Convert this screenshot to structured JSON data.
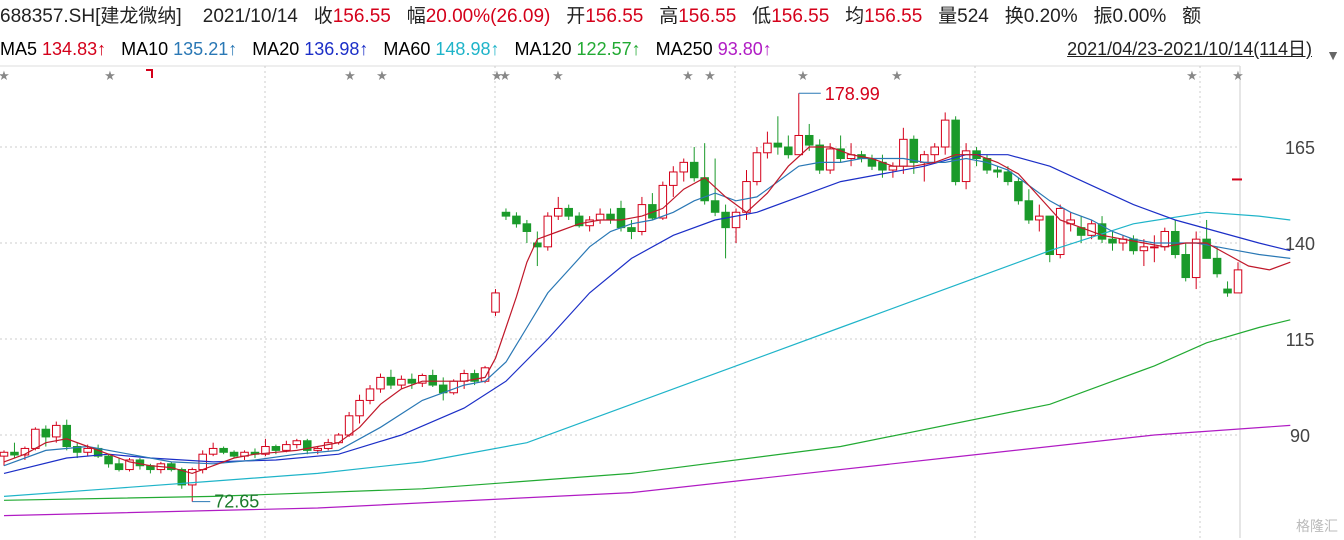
{
  "header": {
    "code": "688357.SH[建龙微纳]",
    "date": "2021/10/14",
    "close_label": "收",
    "close": "156.55",
    "change_label": "幅",
    "change": "20.00%(26.09)",
    "open_label": "开",
    "open": "156.55",
    "high_label": "高",
    "high": "156.55",
    "low_label": "低",
    "low": "156.55",
    "avg_label": "均",
    "avg": "156.55",
    "vol_label": "量",
    "vol": "524",
    "turnover_label": "换",
    "turnover": "0.20%",
    "amp_label": "振",
    "amp": "0.00%",
    "amount_label": "额"
  },
  "ma_bar": {
    "items": [
      {
        "label": "MA5",
        "value": "134.83↑",
        "color": "#c0182a"
      },
      {
        "label": "MA10",
        "value": "135.21↑",
        "color": "#2a78b5"
      },
      {
        "label": "MA20",
        "value": "136.98↑",
        "color": "#1c2fc7"
      },
      {
        "label": "MA60",
        "value": "148.98↑",
        "color": "#1fb4c9"
      },
      {
        "label": "MA120",
        "value": "122.57↑",
        "color": "#22aa33"
      },
      {
        "label": "MA250",
        "value": "93.80↑",
        "color": "#b01bc4"
      }
    ],
    "date_range": "2021/04/23-2021/10/14(114日)",
    "dropdown_icon": "chevron-down-icon"
  },
  "chart_data": {
    "type": "candlestick",
    "y_ticks": [
      165,
      140,
      115,
      90
    ],
    "ylim": [
      70,
      185
    ],
    "annotations": {
      "high": "178.99",
      "low": "72.65"
    },
    "colors": {
      "up": "#d4001a",
      "down": "#1a9a2a",
      "grid": "#cccccc"
    },
    "candles": [
      [
        84.5,
        86,
        82,
        85.5
      ],
      [
        85.5,
        88,
        84,
        84.8
      ],
      [
        84.8,
        87,
        83.5,
        86.5
      ],
      [
        86.5,
        92,
        86,
        91.5
      ],
      [
        91.5,
        92.5,
        87,
        89.5
      ],
      [
        89.5,
        93.5,
        88,
        92.5
      ],
      [
        92.5,
        94,
        86,
        87
      ],
      [
        87,
        88,
        84,
        85.5
      ],
      [
        85.5,
        87.5,
        84.5,
        86.5
      ],
      [
        86.5,
        87.5,
        84,
        84.5
      ],
      [
        84.5,
        85,
        81.5,
        82.5
      ],
      [
        82.5,
        84,
        80.5,
        81
      ],
      [
        81,
        84,
        80.5,
        83.5
      ],
      [
        83.5,
        84,
        81,
        82
      ],
      [
        82,
        82.5,
        80,
        81
      ],
      [
        81,
        83,
        80,
        82.5
      ],
      [
        82.5,
        83,
        80.5,
        81
      ],
      [
        81,
        81.5,
        76,
        77
      ],
      [
        77,
        81.5,
        72.65,
        81
      ],
      [
        81,
        86,
        80,
        85
      ],
      [
        85,
        88,
        84.5,
        86.5
      ],
      [
        86.5,
        87,
        85,
        85.5
      ],
      [
        85.5,
        86,
        84,
        84.5
      ],
      [
        84.5,
        86,
        83.5,
        85.5
      ],
      [
        85.5,
        86.5,
        84,
        85
      ],
      [
        85,
        89,
        84.5,
        87
      ],
      [
        87,
        87.5,
        85,
        86
      ],
      [
        86,
        88.5,
        85.5,
        87.5
      ],
      [
        87.5,
        89,
        86.5,
        88.5
      ],
      [
        88.5,
        89,
        85,
        86
      ],
      [
        86,
        87,
        85,
        86.5
      ],
      [
        86.5,
        89,
        86,
        88
      ],
      [
        88,
        90.5,
        87.5,
        90
      ],
      [
        90,
        96,
        89.5,
        95
      ],
      [
        95,
        100.5,
        93,
        99
      ],
      [
        99,
        103,
        98,
        102
      ],
      [
        102,
        106,
        101,
        105
      ],
      [
        105,
        107,
        102,
        103
      ],
      [
        103,
        105.5,
        102,
        104.5
      ],
      [
        104.5,
        106,
        102,
        103.5
      ],
      [
        103.5,
        106,
        102.5,
        105.5
      ],
      [
        105.5,
        107,
        102.5,
        103
      ],
      [
        103,
        105,
        99,
        101
      ],
      [
        101,
        104.5,
        100.5,
        104
      ],
      [
        104,
        107,
        102,
        106
      ],
      [
        106,
        107,
        103,
        104
      ],
      [
        104,
        108,
        103.5,
        107.5
      ],
      [
        122,
        128,
        121,
        127
      ],
      [
        148,
        149,
        146,
        147
      ],
      [
        147,
        148,
        144,
        145
      ],
      [
        145,
        146,
        140,
        143
      ],
      [
        140,
        143,
        134,
        139
      ],
      [
        139,
        148,
        138,
        147
      ],
      [
        147,
        152,
        146,
        149
      ],
      [
        149,
        150,
        146,
        147
      ],
      [
        147,
        148,
        144,
        144.5
      ],
      [
        144.5,
        147,
        143,
        146
      ],
      [
        146,
        149,
        145,
        147.5
      ],
      [
        147.5,
        149,
        145,
        146
      ],
      [
        149,
        151,
        143,
        144
      ],
      [
        144,
        146,
        141,
        143
      ],
      [
        143,
        152,
        142,
        150
      ],
      [
        150,
        153,
        146,
        146.5
      ],
      [
        146.5,
        156,
        146,
        155
      ],
      [
        155,
        160,
        152,
        158.5
      ],
      [
        158.5,
        162,
        156,
        161
      ],
      [
        161,
        165,
        156,
        157
      ],
      [
        157,
        166,
        150,
        151
      ],
      [
        151,
        162,
        147,
        148
      ],
      [
        148,
        150,
        136,
        144
      ],
      [
        144,
        149,
        140,
        148
      ],
      [
        148,
        159,
        146,
        156
      ],
      [
        156,
        165,
        155,
        163.5
      ],
      [
        163.5,
        169,
        162,
        166
      ],
      [
        166,
        173,
        163,
        165
      ],
      [
        165,
        168,
        162,
        163
      ],
      [
        163,
        179,
        163,
        168
      ],
      [
        168,
        171,
        164,
        165.5
      ],
      [
        165.5,
        167,
        158,
        159
      ],
      [
        159,
        166,
        158,
        164.5
      ],
      [
        164.5,
        168,
        161,
        162
      ],
      [
        162,
        166,
        160,
        163
      ],
      [
        163,
        164,
        161,
        162
      ],
      [
        162,
        163,
        159,
        160
      ],
      [
        161,
        163,
        157,
        159
      ],
      [
        159,
        161,
        157,
        160
      ],
      [
        160,
        170,
        158,
        167
      ],
      [
        167,
        168,
        158,
        161
      ],
      [
        161,
        164,
        156,
        163
      ],
      [
        163,
        166,
        161,
        165
      ],
      [
        165,
        174,
        163,
        172
      ],
      [
        172,
        173,
        155,
        156
      ],
      [
        156,
        166,
        154,
        164
      ],
      [
        164,
        165,
        160,
        162
      ],
      [
        162,
        163,
        158,
        159
      ],
      [
        159,
        160,
        157,
        158.5
      ],
      [
        158.5,
        160,
        155,
        156
      ],
      [
        156,
        157,
        150,
        151
      ],
      [
        151,
        154,
        145,
        146
      ],
      [
        146,
        150,
        143,
        147
      ],
      [
        147,
        147,
        135,
        137
      ],
      [
        137,
        150,
        136,
        149
      ],
      [
        145,
        148,
        143,
        146
      ],
      [
        144,
        147,
        140,
        142
      ],
      [
        142,
        146,
        141,
        145
      ],
      [
        145,
        147,
        140,
        141
      ],
      [
        141,
        143,
        138,
        140
      ],
      [
        140,
        142,
        138,
        141
      ],
      [
        141,
        142,
        137,
        138
      ],
      [
        138,
        141,
        134,
        139
      ],
      [
        139,
        142,
        135,
        139
      ],
      [
        139,
        144,
        138,
        143
      ],
      [
        143,
        146,
        136,
        137
      ],
      [
        137,
        140,
        130,
        131
      ],
      [
        131,
        143,
        128,
        141
      ],
      [
        141,
        146,
        137,
        136
      ],
      [
        136,
        139,
        131,
        132
      ],
      [
        128,
        130,
        126,
        127
      ],
      [
        127,
        135,
        127,
        133
      ]
    ],
    "ma5": [
      [
        0,
        83
      ],
      [
        2,
        85
      ],
      [
        4,
        88
      ],
      [
        6,
        89
      ],
      [
        8,
        87
      ],
      [
        10,
        85
      ],
      [
        12,
        83
      ],
      [
        14,
        82
      ],
      [
        16,
        81.5
      ],
      [
        18,
        80
      ],
      [
        20,
        82
      ],
      [
        22,
        84
      ],
      [
        24,
        85
      ],
      [
        26,
        85.5
      ],
      [
        28,
        86
      ],
      [
        30,
        87
      ],
      [
        32,
        88
      ],
      [
        34,
        92
      ],
      [
        36,
        98
      ],
      [
        38,
        102
      ],
      [
        40,
        104
      ],
      [
        42,
        104
      ],
      [
        44,
        104
      ],
      [
        46,
        105
      ],
      [
        47,
        110
      ],
      [
        48,
        118
      ],
      [
        49,
        126
      ],
      [
        50,
        135
      ],
      [
        51,
        141
      ],
      [
        53,
        143
      ],
      [
        55,
        145
      ],
      [
        57,
        146
      ],
      [
        59,
        146
      ],
      [
        61,
        147
      ],
      [
        63,
        149
      ],
      [
        65,
        154
      ],
      [
        67,
        157
      ],
      [
        69,
        152
      ],
      [
        71,
        148
      ],
      [
        73,
        153
      ],
      [
        75,
        160
      ],
      [
        77,
        165
      ],
      [
        79,
        165
      ],
      [
        81,
        163
      ],
      [
        83,
        162
      ],
      [
        85,
        160
      ],
      [
        87,
        160
      ],
      [
        89,
        161
      ],
      [
        91,
        163
      ],
      [
        93,
        163
      ],
      [
        95,
        161
      ],
      [
        97,
        158
      ],
      [
        99,
        152
      ],
      [
        101,
        146
      ],
      [
        103,
        144
      ],
      [
        105,
        142
      ],
      [
        107,
        141
      ],
      [
        109,
        140
      ],
      [
        111,
        139
      ],
      [
        113,
        140
      ],
      [
        115,
        140
      ],
      [
        117,
        137
      ],
      [
        119,
        134
      ],
      [
        121,
        133
      ],
      [
        123,
        135
      ]
    ],
    "ma10": [
      [
        0,
        82
      ],
      [
        4,
        86
      ],
      [
        8,
        87
      ],
      [
        12,
        85
      ],
      [
        16,
        83
      ],
      [
        20,
        82.5
      ],
      [
        24,
        83.5
      ],
      [
        28,
        85
      ],
      [
        32,
        86
      ],
      [
        36,
        92
      ],
      [
        40,
        99
      ],
      [
        44,
        103
      ],
      [
        46,
        104
      ],
      [
        48,
        109
      ],
      [
        50,
        118
      ],
      [
        52,
        127
      ],
      [
        54,
        133
      ],
      [
        56,
        139
      ],
      [
        58,
        143
      ],
      [
        60,
        145
      ],
      [
        62,
        146
      ],
      [
        64,
        148
      ],
      [
        66,
        151
      ],
      [
        68,
        153
      ],
      [
        70,
        151
      ],
      [
        72,
        152
      ],
      [
        74,
        156
      ],
      [
        76,
        160
      ],
      [
        78,
        161
      ],
      [
        80,
        161
      ],
      [
        82,
        162
      ],
      [
        84,
        162
      ],
      [
        86,
        162
      ],
      [
        88,
        161
      ],
      [
        90,
        161
      ],
      [
        92,
        162
      ],
      [
        94,
        161
      ],
      [
        96,
        159
      ],
      [
        98,
        155
      ],
      [
        100,
        151
      ],
      [
        102,
        148
      ],
      [
        104,
        146
      ],
      [
        106,
        143
      ],
      [
        108,
        141
      ],
      [
        110,
        140
      ],
      [
        112,
        140
      ],
      [
        114,
        140
      ],
      [
        116,
        139
      ],
      [
        118,
        138
      ],
      [
        120,
        137
      ],
      [
        123,
        136
      ]
    ],
    "ma20": [
      [
        0,
        80
      ],
      [
        6,
        84
      ],
      [
        10,
        85
      ],
      [
        14,
        84
      ],
      [
        20,
        83
      ],
      [
        26,
        83.5
      ],
      [
        32,
        85
      ],
      [
        38,
        90
      ],
      [
        44,
        97
      ],
      [
        48,
        104
      ],
      [
        52,
        115
      ],
      [
        56,
        127
      ],
      [
        60,
        136
      ],
      [
        64,
        142
      ],
      [
        68,
        146
      ],
      [
        72,
        148
      ],
      [
        76,
        152
      ],
      [
        80,
        156
      ],
      [
        84,
        158
      ],
      [
        88,
        160
      ],
      [
        92,
        163
      ],
      [
        96,
        163
      ],
      [
        100,
        160
      ],
      [
        104,
        155
      ],
      [
        108,
        150
      ],
      [
        112,
        146
      ],
      [
        116,
        143
      ],
      [
        120,
        140
      ],
      [
        123,
        138
      ]
    ],
    "ma60": [
      [
        0,
        74
      ],
      [
        10,
        76
      ],
      [
        20,
        78
      ],
      [
        30,
        80
      ],
      [
        40,
        83
      ],
      [
        50,
        88
      ],
      [
        60,
        98
      ],
      [
        70,
        108
      ],
      [
        80,
        118
      ],
      [
        90,
        128
      ],
      [
        100,
        138
      ],
      [
        108,
        145
      ],
      [
        115,
        148
      ],
      [
        120,
        147
      ],
      [
        123,
        146
      ]
    ],
    "ma120": [
      [
        0,
        73
      ],
      [
        20,
        74
      ],
      [
        40,
        76
      ],
      [
        60,
        80
      ],
      [
        80,
        87
      ],
      [
        100,
        98
      ],
      [
        110,
        108
      ],
      [
        115,
        114
      ],
      [
        120,
        118
      ],
      [
        123,
        120
      ]
    ],
    "ma250": [
      [
        0,
        69
      ],
      [
        30,
        71
      ],
      [
        60,
        75
      ],
      [
        90,
        84
      ],
      [
        110,
        90
      ],
      [
        123,
        92.5
      ]
    ]
  },
  "watermark": "格隆汇"
}
